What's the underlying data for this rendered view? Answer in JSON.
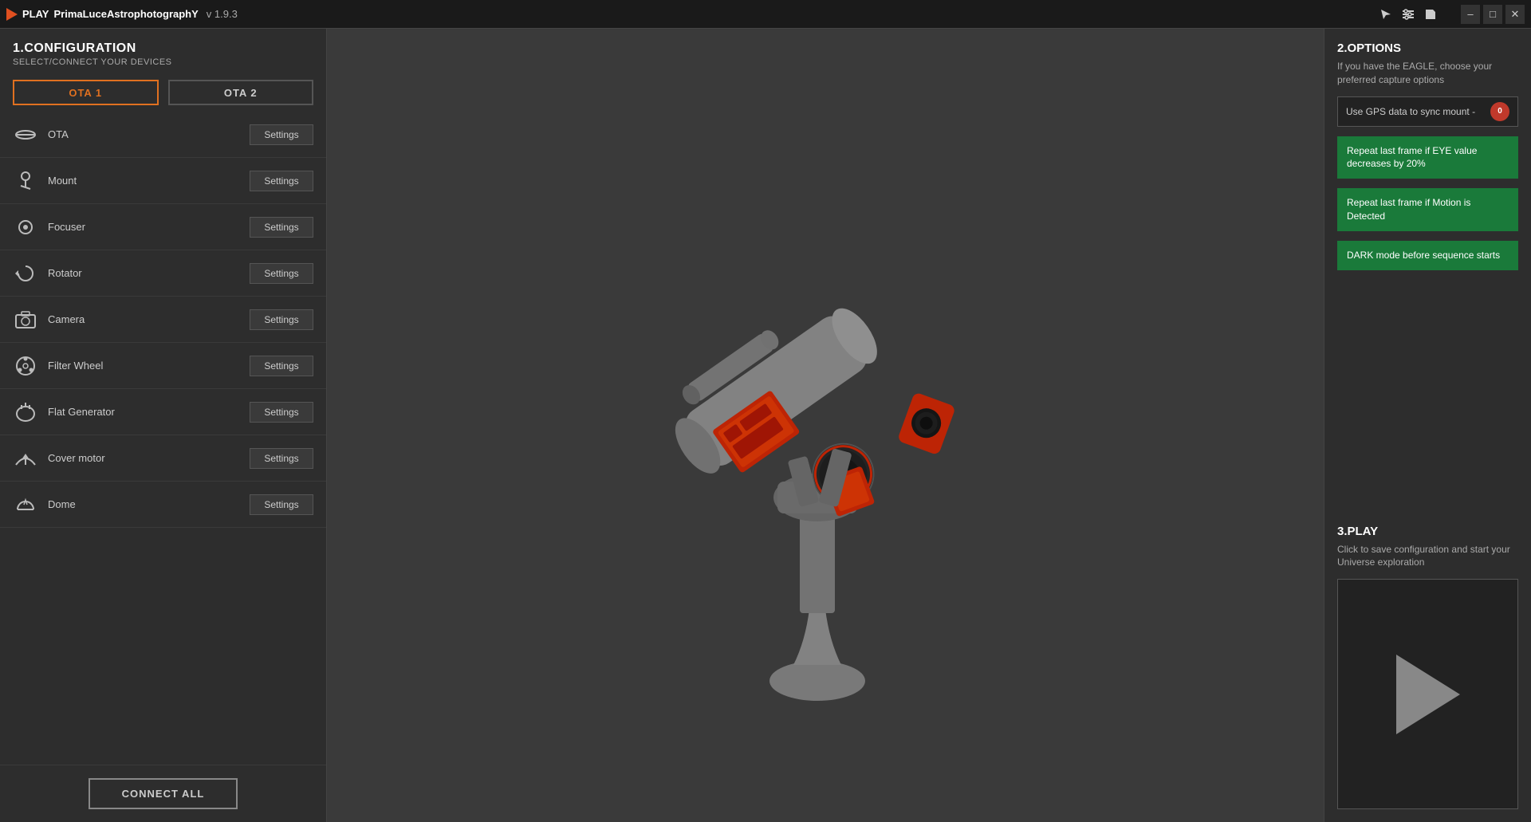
{
  "titlebar": {
    "app_name": "PLAY",
    "logo_text": "PrimaLuceAstrophotographY",
    "version": "v 1.9.3"
  },
  "left_panel": {
    "section_title": "1.CONFIGURATION",
    "section_subtitle": "SELECT/CONNECT YOUR DEVICES",
    "ota_buttons": [
      {
        "label": "OTA 1"
      },
      {
        "label": "OTA 2"
      }
    ],
    "devices": [
      {
        "name": "OTA",
        "icon": "ota-icon"
      },
      {
        "name": "Mount",
        "icon": "mount-icon"
      },
      {
        "name": "Focuser",
        "icon": "focuser-icon"
      },
      {
        "name": "Rotator",
        "icon": "rotator-icon"
      },
      {
        "name": "Camera",
        "icon": "camera-icon"
      },
      {
        "name": "Filter Wheel",
        "icon": "filterwheel-icon"
      },
      {
        "name": "Flat Generator",
        "icon": "flatgenerator-icon"
      },
      {
        "name": "Cover motor",
        "icon": "covermotor-icon"
      },
      {
        "name": "Dome",
        "icon": "dome-icon"
      }
    ],
    "settings_label": "Settings",
    "connect_all_label": "CONNECT ALL"
  },
  "right_panel": {
    "options_title": "2.OPTIONS",
    "options_desc": "If you have the EAGLE, choose your preferred capture options",
    "gps_label": "Use GPS data to sync mount -",
    "gps_toggle_value": "0",
    "green_options": [
      {
        "text": "Repeat last frame if EYE value decreases by 20%"
      },
      {
        "text": "Repeat last frame if Motion is Detected"
      },
      {
        "text": "DARK mode before sequence starts"
      }
    ],
    "play_title": "3.PLAY",
    "play_desc": "Click to save configuration and start your Universe exploration"
  }
}
